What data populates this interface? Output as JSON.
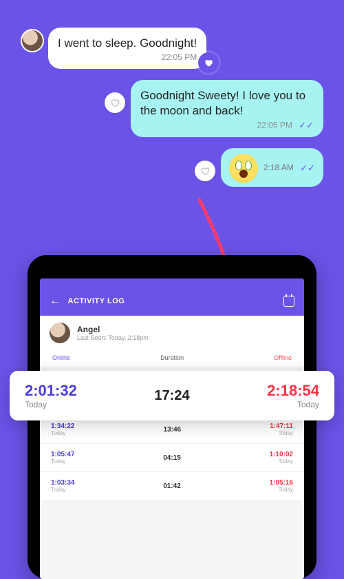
{
  "chat": {
    "messages": [
      {
        "text": "I went to sleep. Goodnight!",
        "time": "22:05 PM",
        "side": "left"
      },
      {
        "text": "Goodnight Sweety! I love you to the moon and back!",
        "time": "22:05 PM",
        "side": "right"
      },
      {
        "emoji": "surprised-face",
        "time": "2:18 AM",
        "side": "right"
      }
    ]
  },
  "tablet": {
    "title": "ACTIVITY LOG",
    "profile": {
      "name": "Angel",
      "last_seen": "Last Seen: Today, 2:18pm"
    },
    "headers": {
      "online": "Online",
      "duration": "Duration",
      "offline": "Offline"
    },
    "highlight": {
      "online_time": "2:01:32",
      "online_sub": "Today",
      "duration": "17:24",
      "offline_time": "2:18:54",
      "offline_sub": "Today"
    },
    "rows": [
      {
        "online": "1:34:22",
        "online_sub": "Today",
        "duration": "13:46",
        "offline": "1:47:11",
        "offline_sub": "Today"
      },
      {
        "online": "1:05:47",
        "online_sub": "Today",
        "duration": "04:15",
        "offline": "1:10:02",
        "offline_sub": "Today"
      },
      {
        "online": "1:03:34",
        "online_sub": "Today",
        "duration": "01:42",
        "offline": "1:05:16",
        "offline_sub": "Today"
      }
    ]
  }
}
